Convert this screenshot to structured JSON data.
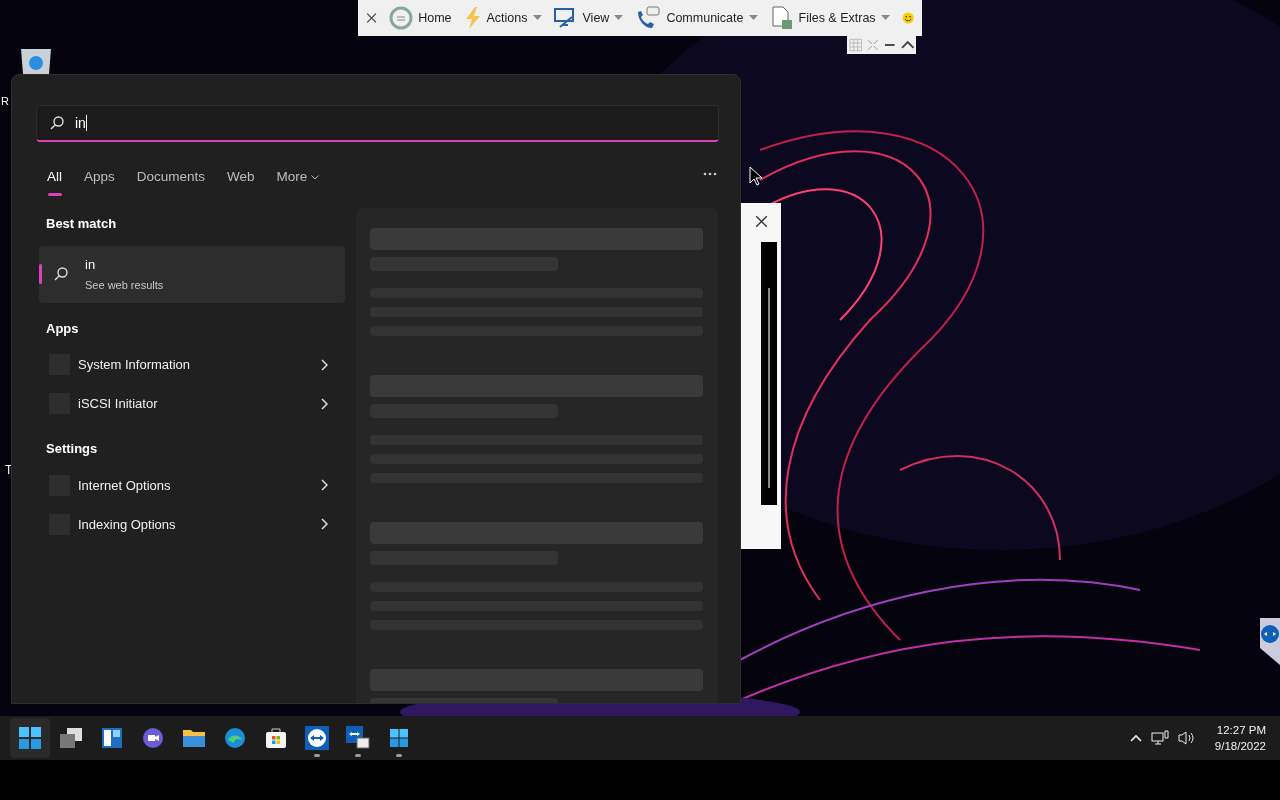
{
  "remote_toolbar": {
    "items": [
      {
        "kind": "home",
        "label": "Home",
        "dropdown": false
      },
      {
        "kind": "actions",
        "label": "Actions",
        "dropdown": true
      },
      {
        "kind": "view",
        "label": "View",
        "dropdown": true
      },
      {
        "kind": "communicate",
        "label": "Communicate",
        "dropdown": true
      },
      {
        "kind": "files",
        "label": "Files & Extras",
        "dropdown": true
      }
    ]
  },
  "desktop_labels": [
    "R",
    "T"
  ],
  "search": {
    "value": "in"
  },
  "tabs": [
    {
      "label": "All",
      "selected": true
    },
    {
      "label": "Apps",
      "selected": false
    },
    {
      "label": "Documents",
      "selected": false
    },
    {
      "label": "Web",
      "selected": false
    },
    {
      "label": "More",
      "selected": false,
      "dropdown": true
    }
  ],
  "best_match": {
    "heading": "Best match",
    "title": "in",
    "subtitle": "See web results"
  },
  "sections": [
    {
      "heading": "Apps",
      "items": [
        "System Information",
        "iSCSI Initiator"
      ]
    },
    {
      "heading": "Settings",
      "items": [
        "Internet Options",
        "Indexing Options"
      ]
    }
  ],
  "taskbar": {
    "apps": [
      {
        "kind": "start",
        "running": false
      },
      {
        "kind": "taskview",
        "running": false
      },
      {
        "kind": "widgets",
        "running": false
      },
      {
        "kind": "chat",
        "running": false
      },
      {
        "kind": "explorer",
        "running": false
      },
      {
        "kind": "edge",
        "running": false
      },
      {
        "kind": "store",
        "running": false
      },
      {
        "kind": "teamviewer",
        "running": true
      },
      {
        "kind": "tvchat",
        "running": true
      },
      {
        "kind": "winapp",
        "running": true
      }
    ],
    "time": "12:27 PM",
    "date": "9/18/2022"
  }
}
